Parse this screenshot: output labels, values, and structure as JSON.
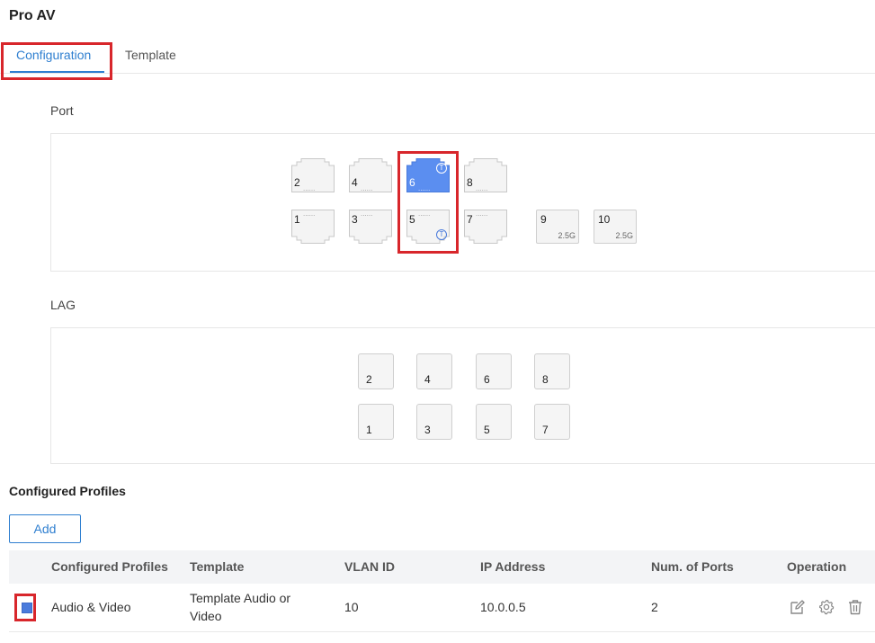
{
  "page": {
    "title": "Pro AV"
  },
  "tabs": [
    {
      "label": "Configuration",
      "active": true
    },
    {
      "label": "Template",
      "active": false
    }
  ],
  "port_section": {
    "label": "Port",
    "ports": [
      {
        "number": "2",
        "row": "top",
        "selected": false,
        "tagged": false
      },
      {
        "number": "4",
        "row": "top",
        "selected": false,
        "tagged": false
      },
      {
        "number": "6",
        "row": "top",
        "selected": true,
        "tagged": true
      },
      {
        "number": "8",
        "row": "top",
        "selected": false,
        "tagged": false
      },
      {
        "number": "1",
        "row": "bottom",
        "selected": false,
        "tagged": false
      },
      {
        "number": "3",
        "row": "bottom",
        "selected": false,
        "tagged": false
      },
      {
        "number": "5",
        "row": "bottom",
        "selected": false,
        "tagged": true
      },
      {
        "number": "7",
        "row": "bottom",
        "selected": false,
        "tagged": false
      }
    ],
    "sfp_ports": [
      {
        "number": "9",
        "speed": "2.5G"
      },
      {
        "number": "10",
        "speed": "2.5G"
      }
    ],
    "tag_glyph": "T",
    "dots": "......"
  },
  "lag_section": {
    "label": "LAG",
    "items": [
      "2",
      "4",
      "6",
      "8",
      "1",
      "3",
      "5",
      "7"
    ]
  },
  "profiles": {
    "title": "Configured Profiles",
    "add_label": "Add",
    "columns": [
      "Configured Profiles",
      "Template",
      "VLAN ID",
      "IP Address",
      "Num. of Ports",
      "Operation"
    ],
    "rows": [
      {
        "profile": "Audio & Video",
        "template_line1": "Template Audio or",
        "template_line2": "Video",
        "vlan_id": "10",
        "ip_address": "10.0.0.5",
        "num_ports": "2",
        "checked": true,
        "operations": [
          "edit-icon",
          "gear-icon",
          "trash-icon"
        ]
      }
    ]
  },
  "colors": {
    "accent": "#2f7fd0",
    "port_selected": "#5b8ef0",
    "highlight": "#d8262b"
  }
}
